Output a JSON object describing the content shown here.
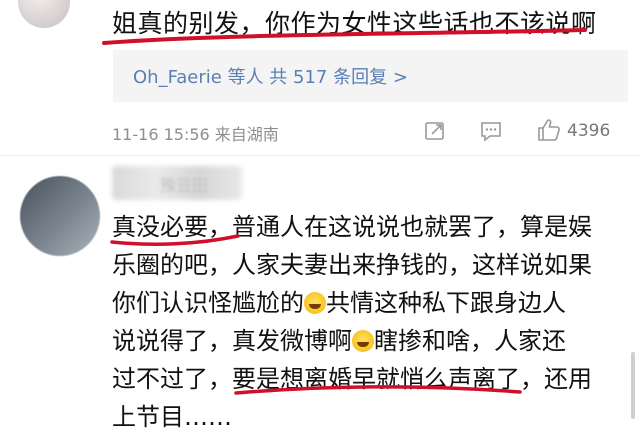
{
  "comment1": {
    "text": "姐真的别发，你作为女性这些话也不该说啊",
    "replies": "Oh_Faerie 等人  共 517 条回复 >",
    "time": "11-16 15:56",
    "location": "来自湖南",
    "likes": "4396",
    "icons": [
      "share-icon",
      "comment-icon",
      "like-icon"
    ]
  },
  "comment2": {
    "username_partial": "豫豆田",
    "lines": [
      "真没必要，普通人在这说说也就罢了，算是娱",
      "乐圈的吧，人家夫妻出来挣钱的，这样说如果",
      [
        "你们认识怪尴尬的",
        "共情这种私下跟身边人"
      ],
      [
        "说说得了，真发微博啊",
        "瞎掺和啥，人家还"
      ],
      "过不过了，要是想离婚早就悄么声离了，还用",
      "上节目……"
    ]
  },
  "colors": {
    "underline": "#d0102a",
    "link": "#5a7fb4",
    "meta": "#8e8e8e"
  }
}
